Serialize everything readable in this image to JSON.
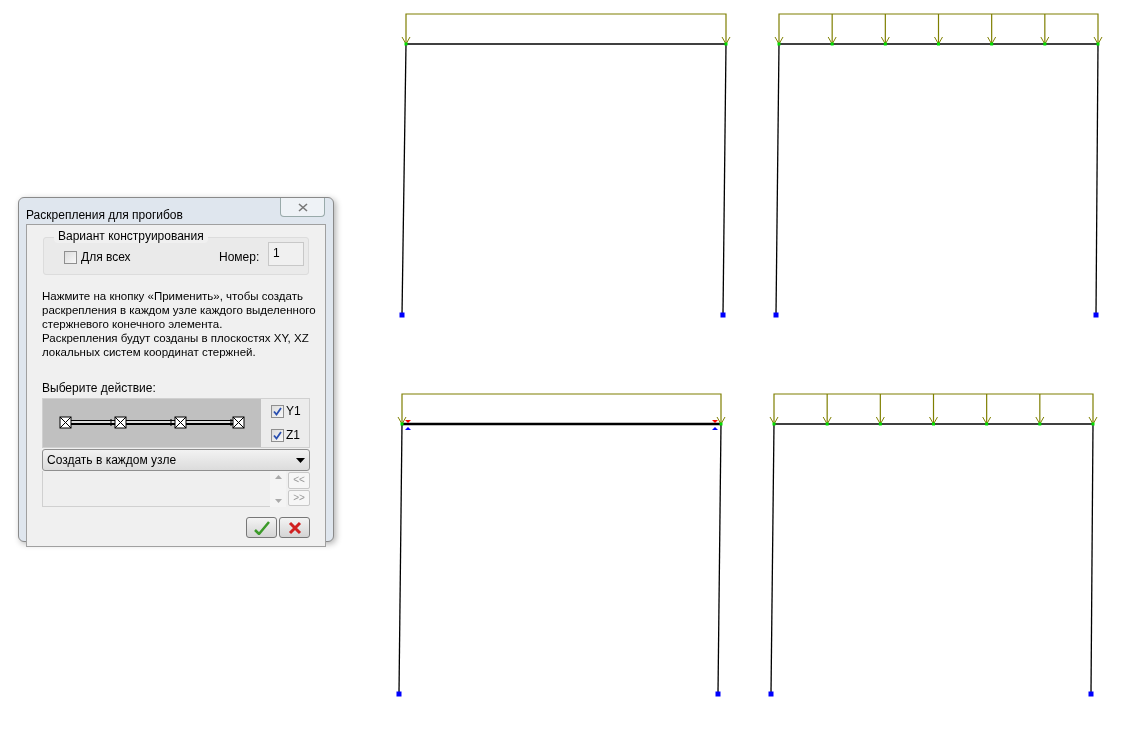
{
  "dialog": {
    "title": "Раскрепления для прогибов",
    "group": {
      "title": "Вариант конструирования",
      "checkbox": {
        "label": "Для всех",
        "checked": false
      },
      "number_label": "Номер:",
      "number_value": "1"
    },
    "description": [
      "Нажмите на кнопку «Применить», чтобы создать раскрепления в каждом узле каждого выделенного стержневого конечного элемента.",
      "Раскрепления будут созданы в плоскостях XY, XZ локальных систем координат стержней."
    ],
    "action_label": "Выберите действие:",
    "axes": [
      {
        "label": "Y1",
        "checked": true
      },
      {
        "label": "Z1",
        "checked": true
      }
    ],
    "action_dropdown": "Создать в каждом узле",
    "list_buttons": [
      "<<",
      ">>"
    ]
  },
  "frames": [
    {
      "kind": "end-arrows",
      "restraints": false
    },
    {
      "kind": "multi-arrows",
      "restraints": false
    },
    {
      "kind": "end-arrows",
      "restraints": true
    },
    {
      "kind": "multi-arrows",
      "restraints": false
    }
  ]
}
